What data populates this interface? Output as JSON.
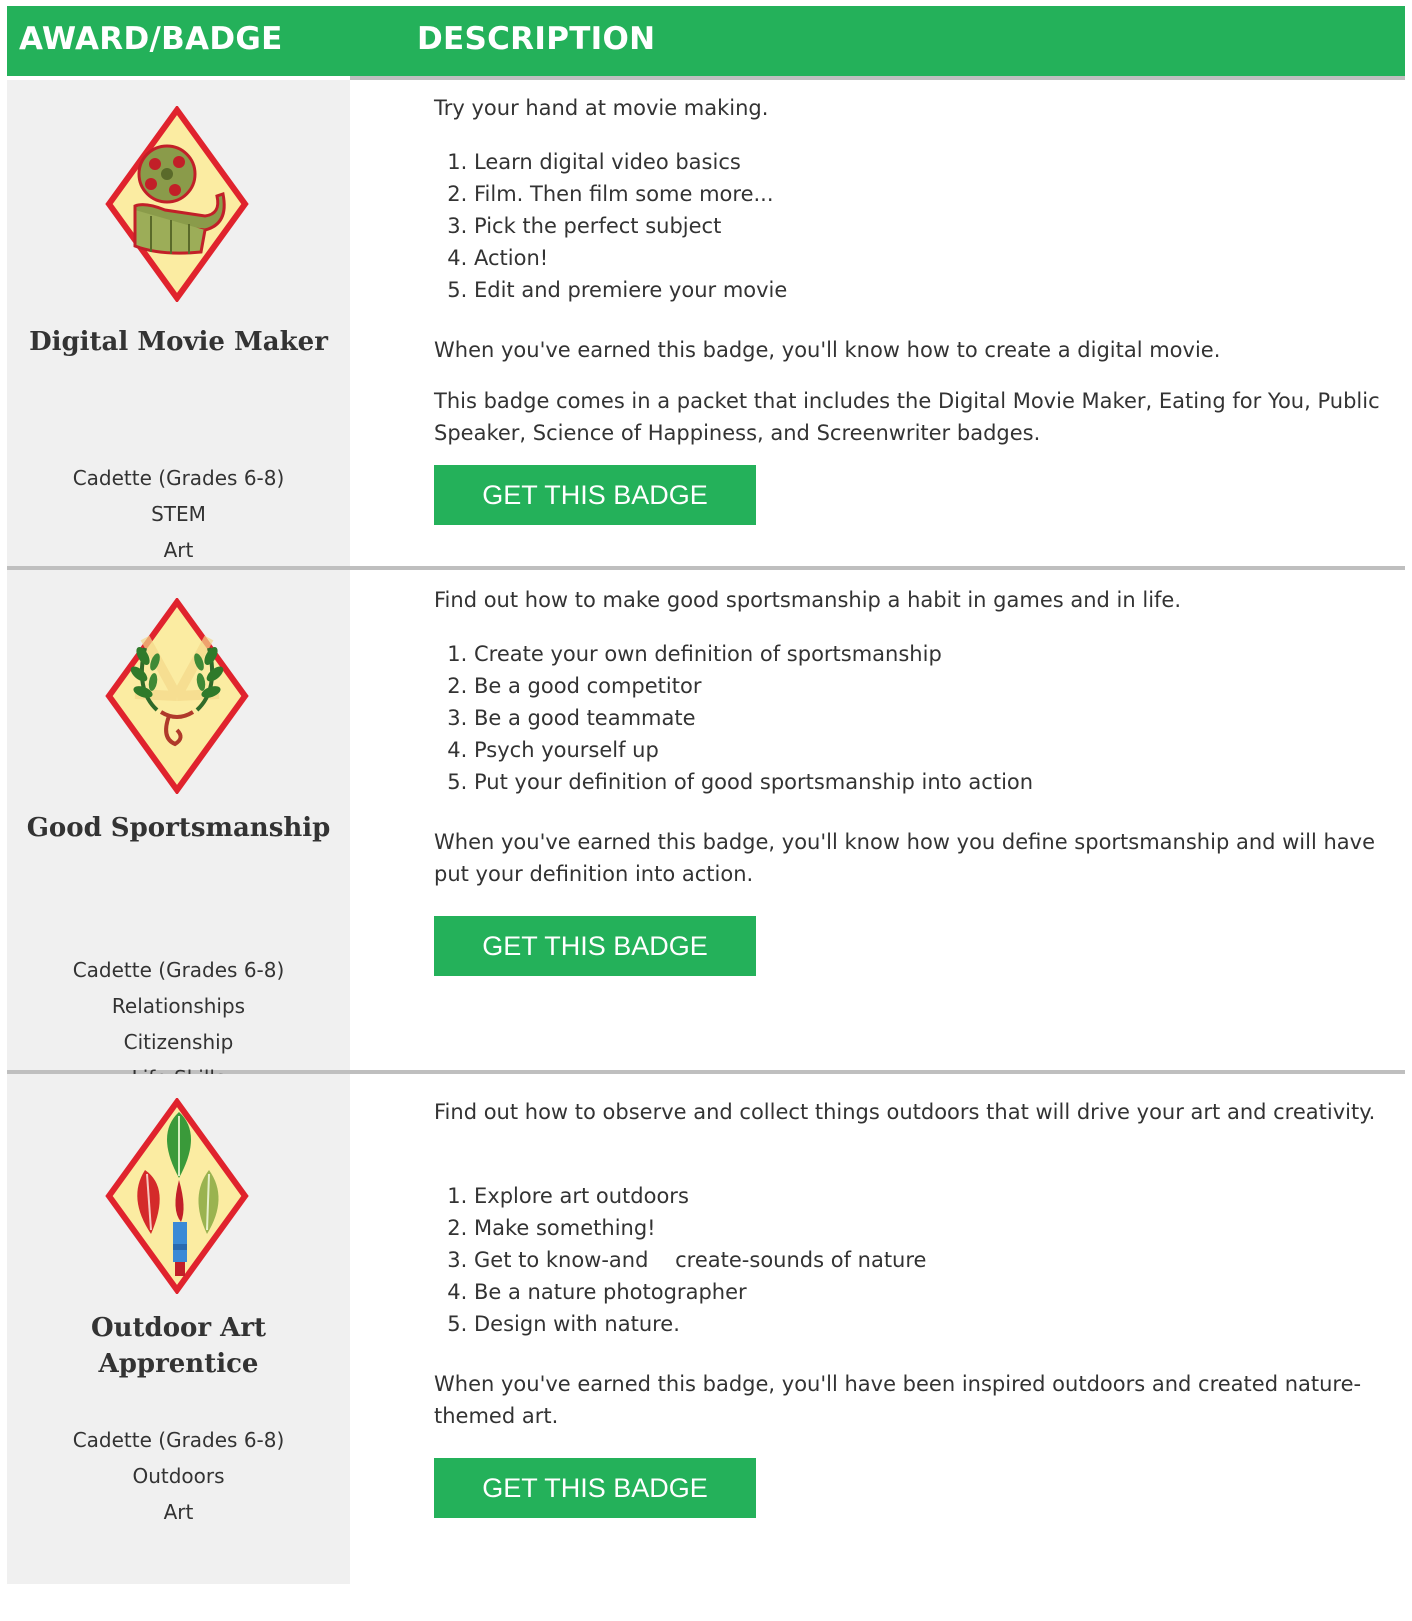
{
  "header": {
    "col1": "AWARD/BADGE",
    "col2": "DESCRIPTION"
  },
  "badges": [
    {
      "name": "Digital Movie Maker",
      "name_lines": [
        "Digital Movie Maker"
      ],
      "meta": [
        "Cadette (Grades 6-8)",
        "STEM",
        "Art"
      ],
      "intro": "Try your hand at movie making.",
      "steps": [
        "Learn digital video basics",
        "Film. Then film some more...",
        "Pick the perfect subject",
        "Action!",
        "Edit and premiere your movie"
      ],
      "paragraphs": [
        "When you've earned this badge, you'll know how to create a digital movie.",
        "This badge comes in a packet that includes the Digital Movie Maker, Eating for You, Public Speaker, Science of Happiness, and Screenwriter badges."
      ],
      "button": "GET THIS BADGE",
      "icon": "film-reel-icon"
    },
    {
      "name": "Good Sportsmanship",
      "name_lines": [
        "Good Sportsmanship"
      ],
      "meta": [
        "Cadette (Grades 6-8)",
        "Relationships",
        "Citizenship",
        "Life Skills"
      ],
      "intro": "Find out how to make good sportsmanship a habit in games and in life.",
      "steps": [
        "Create your own definition of sportsmanship",
        "Be a good competitor",
        "Be a good teammate",
        "Psych yourself up",
        "Put your definition of good sportsmanship into action"
      ],
      "paragraphs": [
        "When you've earned this badge, you'll know how you define sportsmanship and will have put your definition into action."
      ],
      "button": "GET THIS BADGE",
      "icon": "laurel-wreath-icon"
    },
    {
      "name": "Outdoor Art Apprentice",
      "name_lines": [
        "Outdoor Art",
        "Apprentice"
      ],
      "meta": [
        "Cadette (Grades 6-8)",
        "Outdoors",
        "Art"
      ],
      "intro": "Find out how to observe and collect things outdoors that will drive your art and creativity.",
      "steps": [
        "Explore art outdoors",
        "Make something!",
        "Get to know-and    create-sounds of nature",
        "Be a nature photographer",
        "Design with nature."
      ],
      "paragraphs": [
        "When you've earned this badge, you'll have been inspired outdoors and created nature-themed art."
      ],
      "button": "GET THIS BADGE",
      "icon": "leaves-paintbrush-icon"
    }
  ],
  "colors": {
    "header": "#24b15a",
    "button": "#24b15a",
    "left_bg": "#f0f0f0",
    "separator": "#bfbfbf",
    "badge_border": "#e0232d",
    "badge_fill": "#fbeca2"
  }
}
